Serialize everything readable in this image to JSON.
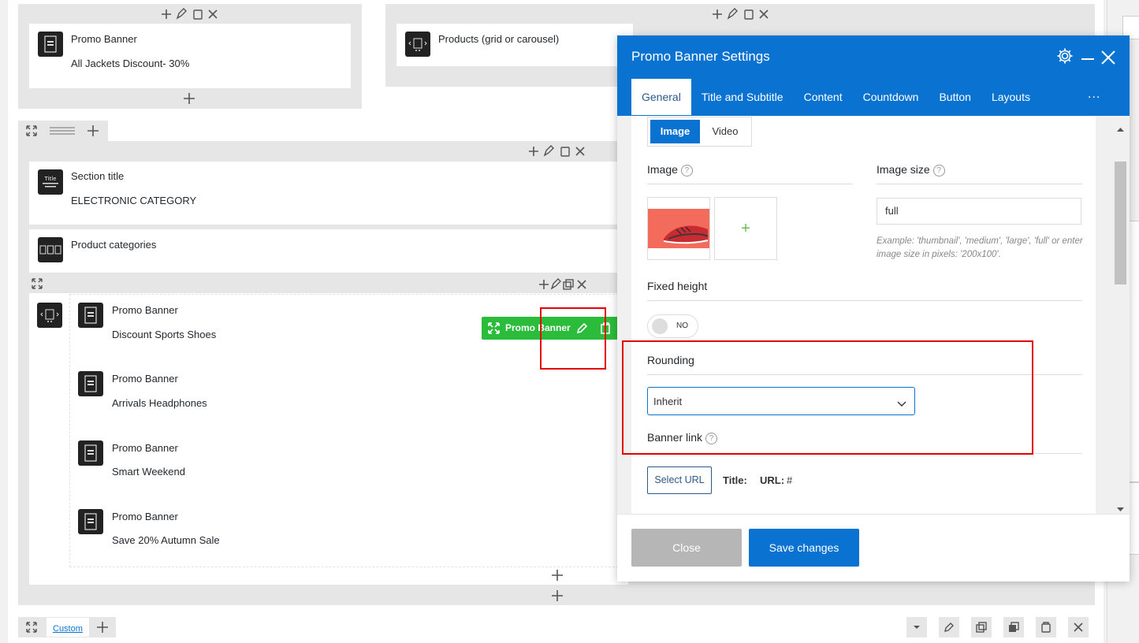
{
  "builder": {
    "top_left_element": {
      "title": "Promo Banner",
      "subtitle": "All Jackets Discount- 30%"
    },
    "top_right_element": {
      "title": "Products (grid or carousel)"
    },
    "section_title_element": {
      "title": "Section title",
      "subtitle": "ELECTRONIC CATEGORY",
      "icon_text": "Title"
    },
    "product_categories_element": {
      "title": "Product categories"
    },
    "carousel_items": [
      {
        "title": "Promo Banner",
        "subtitle": "Discount Sports Shoes"
      },
      {
        "title": "Promo Banner",
        "subtitle": "Arrivals Headphones"
      },
      {
        "title": "Promo Banner",
        "subtitle": "Smart Weekend"
      },
      {
        "title": "Promo Banner",
        "subtitle": "Save 20% Autumn Sale"
      }
    ],
    "hover_toolbar": {
      "label": "Promo Banner"
    },
    "bottom_row": {
      "custom_label": "Custom"
    }
  },
  "modal": {
    "title": "Promo Banner Settings",
    "tabs": [
      "General",
      "Title and Subtitle",
      "Content",
      "Countdown",
      "Button",
      "Layouts",
      "..."
    ],
    "active_tab": "General",
    "media_toggle": {
      "image": "Image",
      "video": "Video"
    },
    "image_label": "Image",
    "image_size_label": "Image size",
    "image_size_value": "full",
    "image_size_help": "Example: 'thumbnail', 'medium', 'large', 'full' or enter image size in pixels: '200x100'.",
    "add_image_symbol": "+",
    "fixed_height_label": "Fixed height",
    "fixed_height_toggle": "NO",
    "rounding_label": "Rounding",
    "rounding_value": "Inherit",
    "banner_link_label": "Banner link",
    "select_url_button": "Select URL",
    "title_field_label": "Title:",
    "url_field_label": "URL:",
    "url_field_value": "#",
    "close_button": "Close",
    "save_button": "Save changes",
    "help_symbol": "?"
  },
  "colors": {
    "modal_header": "#0a73d2",
    "save_button": "#0a73d2",
    "close_button": "#b6b6b6",
    "hover_toolbar": "#2cbc3c",
    "highlight_box": "#e30000"
  }
}
